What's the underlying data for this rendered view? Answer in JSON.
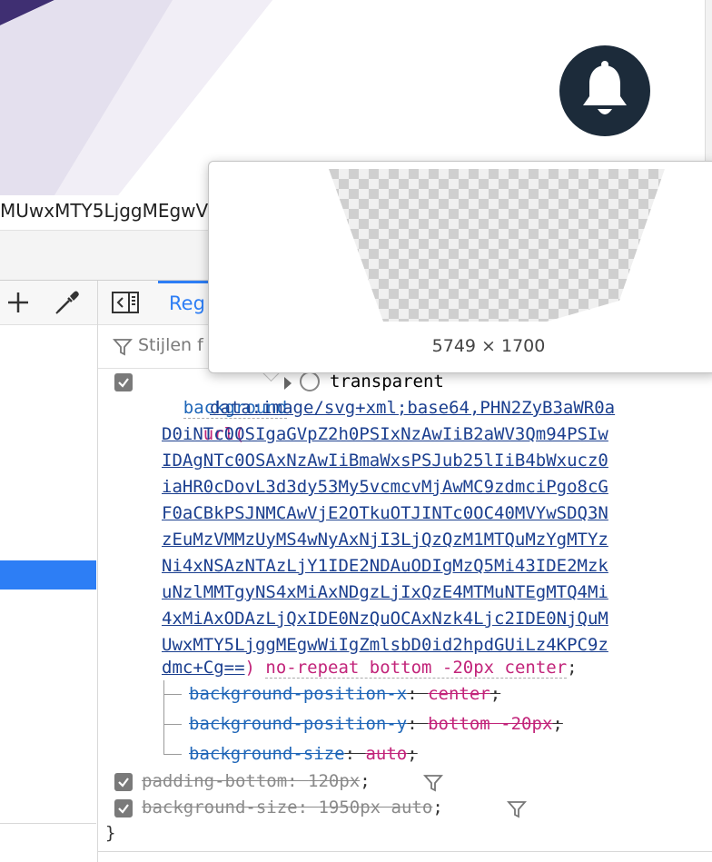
{
  "page": {
    "url_fragment": "MUwxMTY5LjggMEgwV"
  },
  "devtools": {
    "tabs": [
      {
        "label": "Reg"
      }
    ],
    "filter": {
      "placeholder": "Stijlen f"
    },
    "tooltip": {
      "image_size": "5749 × 1700"
    },
    "declarations": {
      "background": {
        "name": "background",
        "color_value": "transparent",
        "url_open": "url(",
        "url_lines": [
          "data:image/svg+xml;base64,PHN2ZyB3aWR0a",
          "D0iNTc0OSIgaGVpZ2h0PSIxNzAwIiB2aWV3Qm94PSIw",
          "IDAgNTc0OSAxNzAwIiBmaWxsPSJub25lIiB4bWxucz0",
          "iaHR0cDovL3d3dy53My5vcmcvMjAwMC9zdmciPgo8cG",
          "F0aCBkPSJNMCAwVjE2OTkuOTJINTc0OC40MVYwSDQ3N",
          "zEuMzVMMzUyMS4wNyAxNjI3LjQzQzM1MTQuMzYgMTYz",
          "Ni4xNSAzNTAzLjY1IDE2NDAuODIgMzQ5Mi43IDE2Mzk",
          "uNzlMMTgyNS4xMiAxNDgzLjIxQzE4MTMuNTEgMTQ4Mi",
          "4xMiAxODAzLjQxIDE0NzQuOCAxNzk4Ljc2IDE0NjQuM",
          "UwxMTY5LjggMEgwWiIgZmlsbD0id2hpdGUiLz4KPC9z",
          "dmc+Cg=="
        ],
        "url_close": ")",
        "tail": "no-repeat bottom -20px center",
        "semicolon": ";",
        "longhands": [
          {
            "name": "background-position-x",
            "value": "center"
          },
          {
            "name": "background-position-y",
            "value": "bottom -20px"
          },
          {
            "name": "background-size",
            "value": "auto"
          }
        ]
      },
      "padding_bottom": {
        "name": "padding-bottom",
        "value": "120px"
      },
      "background_size": {
        "name": "background-size",
        "value": "1950px auto"
      },
      "closing_brace": "}"
    }
  },
  "colors": {
    "accent": "#2d7ef5",
    "property": "#1f66b8",
    "value": "#c2247a",
    "bell_bg": "#1c2b3a",
    "hero": "#4b3a7a"
  }
}
